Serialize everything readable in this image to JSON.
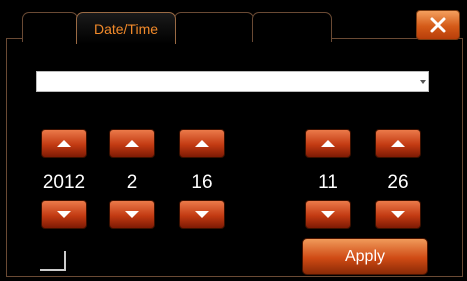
{
  "tabs": [
    {
      "label": ""
    },
    {
      "label": "Date/Time"
    },
    {
      "label": ""
    },
    {
      "label": ""
    }
  ],
  "close_icon": "close-x-icon",
  "timezone_select": {
    "value": ""
  },
  "date": {
    "year": "2012",
    "month": "2",
    "day": "16"
  },
  "time": {
    "hour": "11",
    "minute": "26"
  },
  "apply_label": "Apply",
  "colors": {
    "accent": "#d45a18",
    "tab_text": "#f28a2a",
    "border": "#6a4a34"
  }
}
